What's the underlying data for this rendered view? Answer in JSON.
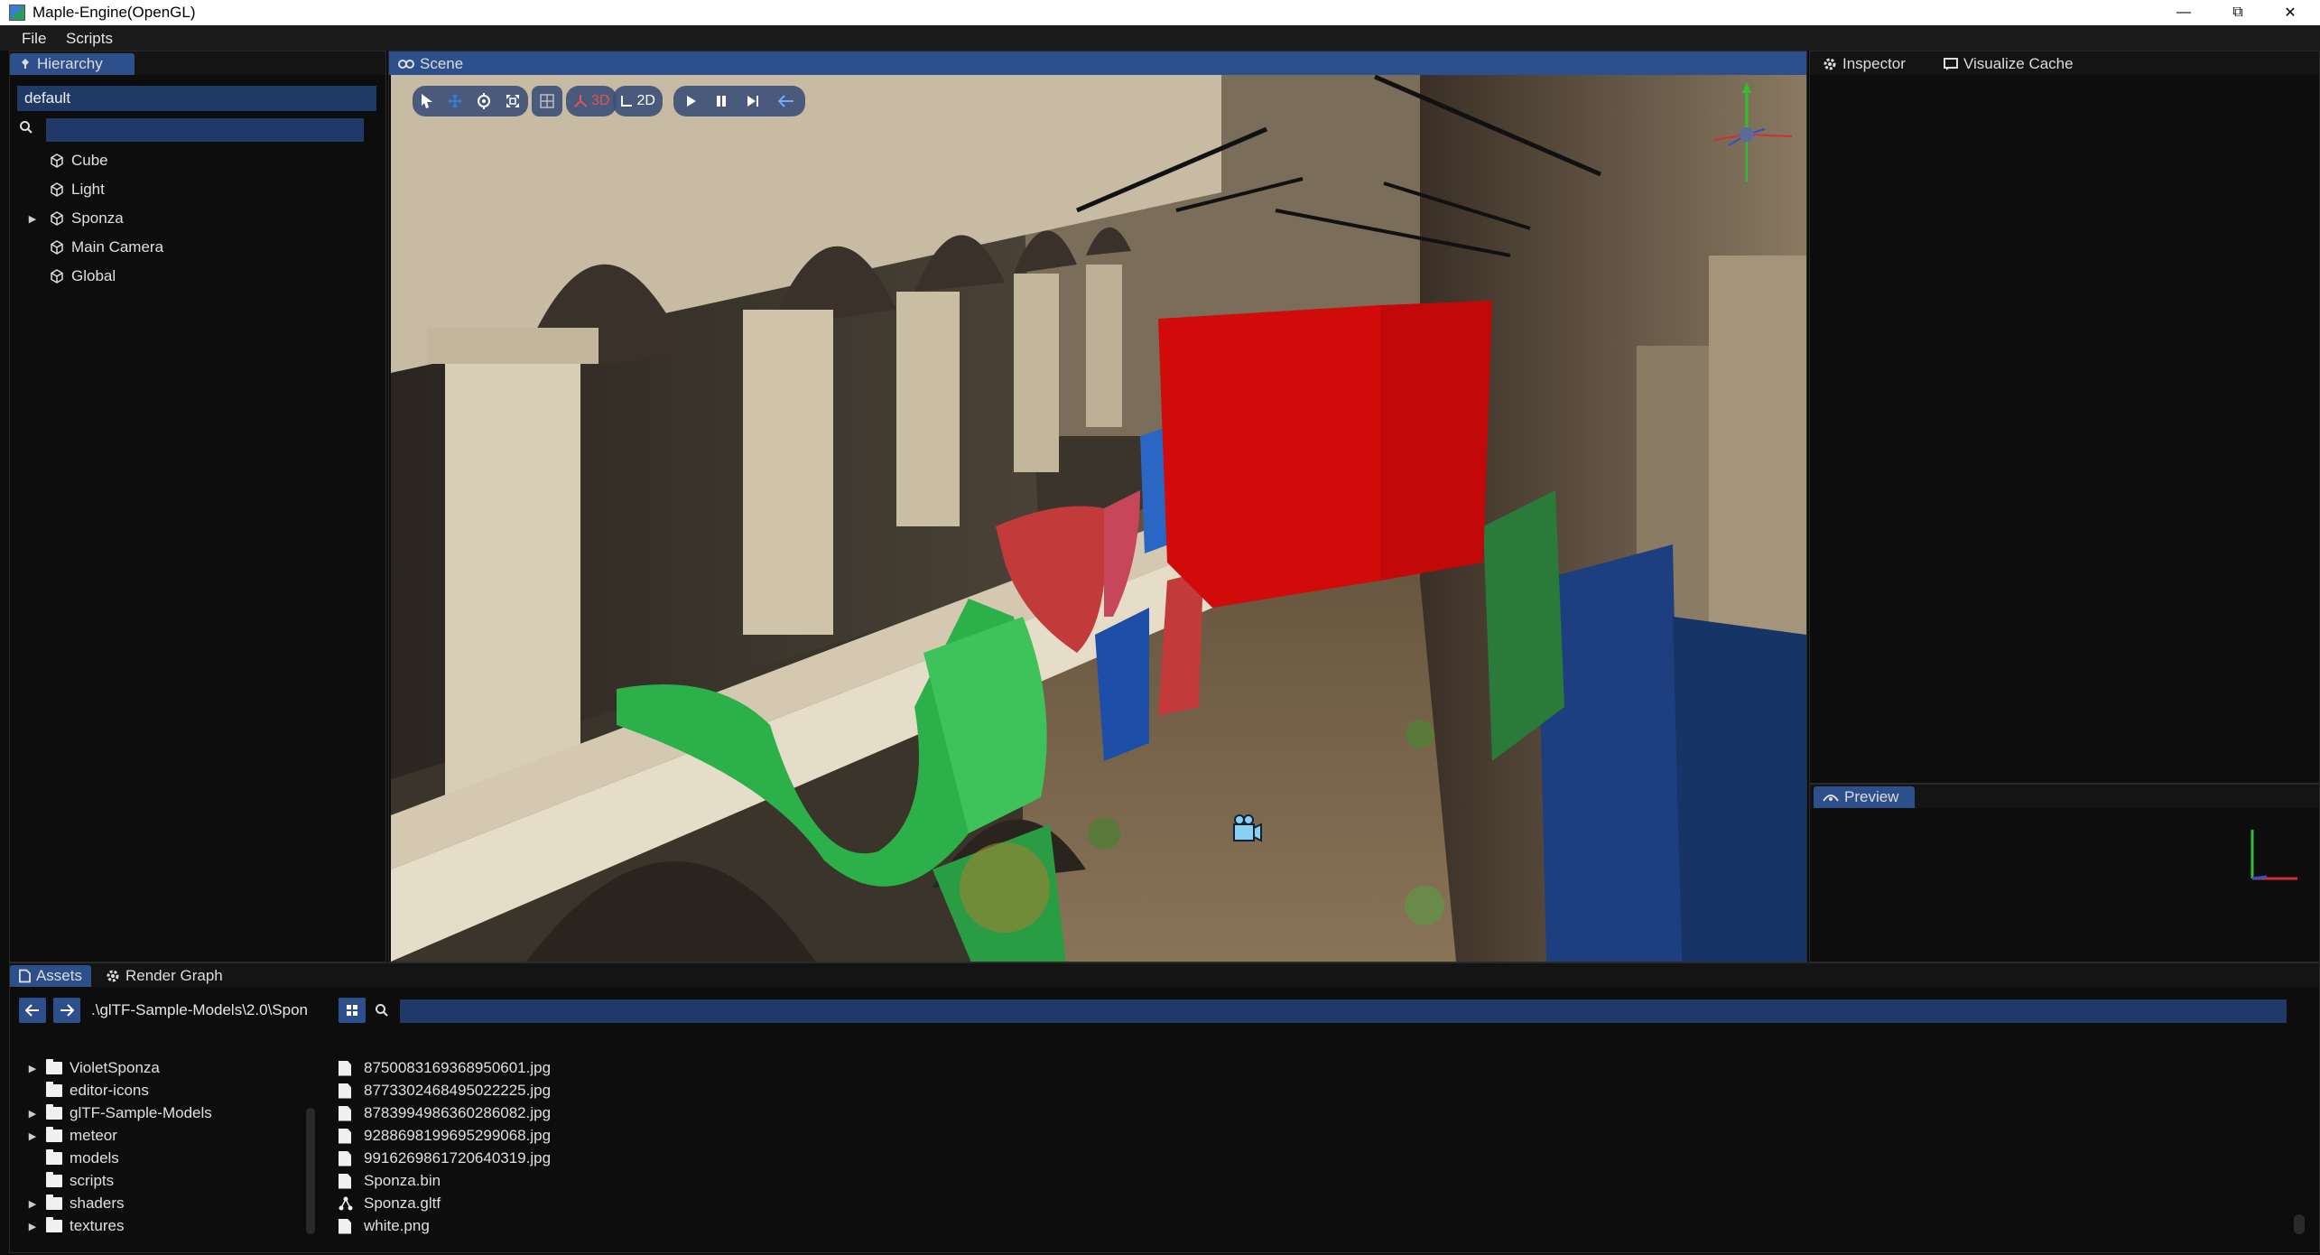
{
  "window": {
    "title": "Maple-Engine(OpenGL)",
    "minimize": "—",
    "restore": "⧉",
    "close": "✕"
  },
  "menu": {
    "items": [
      "File",
      "Scripts"
    ]
  },
  "hierarchy": {
    "tab_label": "Hierarchy",
    "scene_name": "default",
    "search_value": "",
    "items": [
      {
        "label": "Cube",
        "expandable": false
      },
      {
        "label": "Light",
        "expandable": false
      },
      {
        "label": "Sponza",
        "expandable": true
      },
      {
        "label": "Main Camera",
        "expandable": false
      },
      {
        "label": "Global",
        "expandable": false
      }
    ]
  },
  "scene": {
    "tab_label": "Scene",
    "toolbar": {
      "mode_3d": "3D",
      "mode_2d": "2D"
    }
  },
  "inspector": {
    "tabs": [
      "Inspector",
      "Visualize Cache"
    ]
  },
  "preview": {
    "tab_label": "Preview"
  },
  "assets": {
    "tabs": [
      "Assets",
      "Render Graph"
    ],
    "path": ".\\glTF-Sample-Models\\2.0\\Spon",
    "search_value": "",
    "folders": [
      {
        "label": "VioletSponza",
        "expandable": true
      },
      {
        "label": "editor-icons",
        "expandable": false
      },
      {
        "label": "glTF-Sample-Models",
        "expandable": true
      },
      {
        "label": "meteor",
        "expandable": true
      },
      {
        "label": "models",
        "expandable": false
      },
      {
        "label": "scripts",
        "expandable": false
      },
      {
        "label": "shaders",
        "expandable": true
      },
      {
        "label": "textures",
        "expandable": true
      }
    ],
    "files": [
      {
        "label": "8750083169368950601.jpg",
        "icon": "image-file-icon"
      },
      {
        "label": "8773302468495022225.jpg",
        "icon": "image-file-icon"
      },
      {
        "label": "8783994986360286082.jpg",
        "icon": "image-file-icon"
      },
      {
        "label": "9288698199695299068.jpg",
        "icon": "image-file-icon"
      },
      {
        "label": "9916269861720640319.jpg",
        "icon": "image-file-icon"
      },
      {
        "label": "Sponza.bin",
        "icon": "binary-file-icon"
      },
      {
        "label": "Sponza.gltf",
        "icon": "gltf-file-icon"
      },
      {
        "label": "white.png",
        "icon": "image-file-icon"
      }
    ]
  },
  "colors": {
    "accent": "#2d4f8c",
    "field": "#1f3a66",
    "panel_bg": "#0d0d0d",
    "cube_red": "#d10a0a",
    "drape_green": "#2bb04a",
    "drape_red": "#c23a3a",
    "drape_blue": "#1d4fa8"
  }
}
